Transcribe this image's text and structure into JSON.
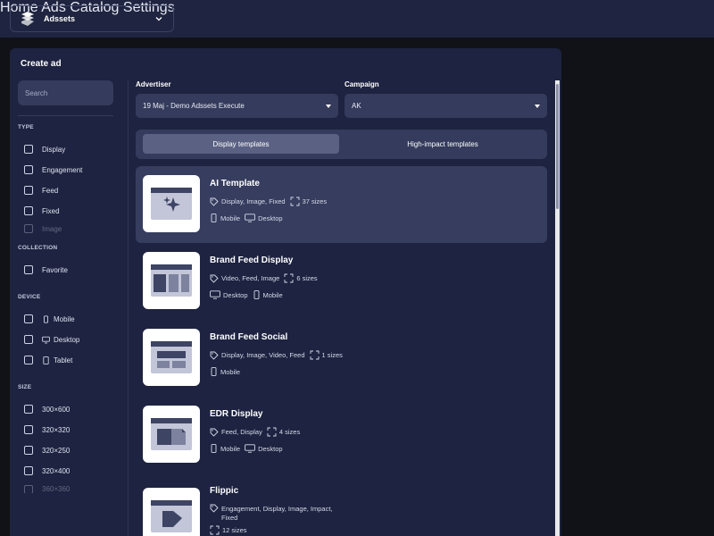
{
  "workspace": {
    "name": "Adssets"
  },
  "nav": [
    "Home",
    "Ads",
    "Catalog",
    "Settings"
  ],
  "panel": {
    "title": "Create ad"
  },
  "search": {
    "placeholder": "Search"
  },
  "filters": {
    "type": {
      "title": "TYPE",
      "items": [
        "Display",
        "Engagement",
        "Feed",
        "Fixed",
        "Image"
      ]
    },
    "collection": {
      "title": "COLLECTION",
      "items": [
        "Favorite"
      ]
    },
    "device": {
      "title": "DEVICE",
      "items": [
        "Mobile",
        "Desktop",
        "Tablet"
      ]
    },
    "size": {
      "title": "SIZE",
      "items": [
        "300×600",
        "320×320",
        "320×250",
        "320×400",
        "360×360"
      ]
    }
  },
  "advertiser": {
    "label": "Advertiser",
    "value": "19 Maj - Demo Adssets Execute"
  },
  "campaign": {
    "label": "Campaign",
    "value": "AK"
  },
  "tabs": [
    "Display templates",
    "High-impact templates"
  ],
  "templates": [
    {
      "title": "AI Template",
      "tags": "Display, Image, Fixed",
      "sizes": "37 sizes",
      "devices": [
        "Mobile",
        "Desktop"
      ]
    },
    {
      "title": "Brand Feed Display",
      "tags": "Video, Feed, Image",
      "sizes": "6 sizes",
      "devices": [
        "Desktop",
        "Mobile"
      ]
    },
    {
      "title": "Brand Feed Social",
      "tags": "Display, Image, Video, Feed",
      "sizes": "1 sizes",
      "devices": [
        "Mobile"
      ]
    },
    {
      "title": "EDR Display",
      "tags": "Feed, Display",
      "sizes": "4 sizes",
      "devices": [
        "Mobile",
        "Desktop"
      ]
    },
    {
      "title": "Flippic",
      "tags_line1": "Engagement, Display, Image, Impact,",
      "tags_line2": "Fixed",
      "sizes": "12 sizes"
    }
  ],
  "colors": {
    "topbar": "#1f2540",
    "panel": "#1d2340",
    "control": "#343b5c",
    "background": "#111217"
  }
}
